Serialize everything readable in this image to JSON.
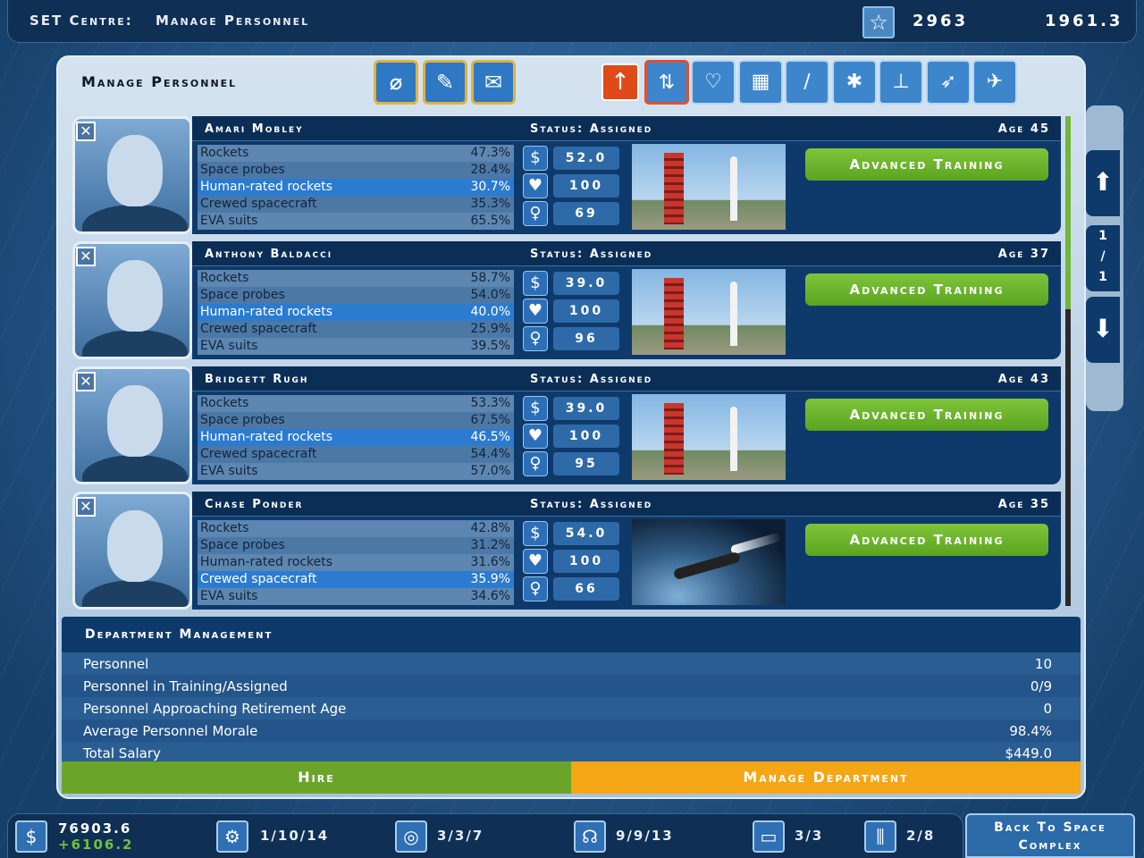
{
  "topbar": {
    "title": "SET Centre:",
    "subtitle": "Manage Personnel",
    "reputation": "2963",
    "date": "1961.3"
  },
  "panel": {
    "title": "Manage Personnel"
  },
  "personnel": [
    {
      "name": "Amari Mobley",
      "status": "Status: Assigned",
      "age": "Age 45",
      "skills": [
        {
          "n": "Rockets",
          "p": "47.3%"
        },
        {
          "n": "Space probes",
          "p": "28.4%"
        },
        {
          "n": "Human-rated rockets",
          "p": "30.7%"
        },
        {
          "n": "Crewed spacecraft",
          "p": "35.3%"
        },
        {
          "n": "EVA suits",
          "p": "65.5%"
        }
      ],
      "salary": "52.0",
      "morale": "100",
      "skill": "69",
      "action": "Advanced Training"
    },
    {
      "name": "Anthony Baldacci",
      "status": "Status: Assigned",
      "age": "Age 37",
      "skills": [
        {
          "n": "Rockets",
          "p": "58.7%"
        },
        {
          "n": "Space probes",
          "p": "54.0%"
        },
        {
          "n": "Human-rated rockets",
          "p": "40.0%"
        },
        {
          "n": "Crewed spacecraft",
          "p": "25.9%"
        },
        {
          "n": "EVA suits",
          "p": "39.5%"
        }
      ],
      "salary": "39.0",
      "morale": "100",
      "skill": "96",
      "action": "Advanced Training"
    },
    {
      "name": "Bridgett Rugh",
      "status": "Status: Assigned",
      "age": "Age 43",
      "skills": [
        {
          "n": "Rockets",
          "p": "53.3%"
        },
        {
          "n": "Space probes",
          "p": "67.5%"
        },
        {
          "n": "Human-rated rockets",
          "p": "46.5%"
        },
        {
          "n": "Crewed spacecraft",
          "p": "54.4%"
        },
        {
          "n": "EVA suits",
          "p": "57.0%"
        }
      ],
      "salary": "39.0",
      "morale": "100",
      "skill": "95",
      "action": "Advanced Training"
    },
    {
      "name": "Chase Ponder",
      "status": "Status: Assigned",
      "age": "Age 35",
      "skills": [
        {
          "n": "Rockets",
          "p": "42.8%"
        },
        {
          "n": "Space probes",
          "p": "31.2%"
        },
        {
          "n": "Human-rated rockets",
          "p": "31.6%"
        },
        {
          "n": "Crewed spacecraft",
          "p": "35.9%"
        },
        {
          "n": "EVA suits",
          "p": "34.6%"
        }
      ],
      "salary": "54.0",
      "morale": "100",
      "skill": "66",
      "action": "Advanced Training"
    }
  ],
  "pager": {
    "current": "1",
    "sep": "/",
    "total": "1"
  },
  "department": {
    "title": "Department Management",
    "rows": [
      {
        "label": "Personnel",
        "value": "10"
      },
      {
        "label": "Personnel in Training/Assigned",
        "value": "0/9"
      },
      {
        "label": "Personnel Approaching Retirement Age",
        "value": "0"
      },
      {
        "label": "Average Personnel Morale",
        "value": "98.4%"
      },
      {
        "label": "Total Salary",
        "value": "$449.0"
      }
    ],
    "hire": "Hire",
    "manage": "Manage Department"
  },
  "bottom": {
    "cash": "76903.6",
    "income": "+6106.2",
    "stat1": "1/10/14",
    "stat2": "3/3/7",
    "stat3": "9/9/13",
    "stat4": "3/3",
    "stat5": "2/8",
    "back": "Back To Space Complex"
  }
}
